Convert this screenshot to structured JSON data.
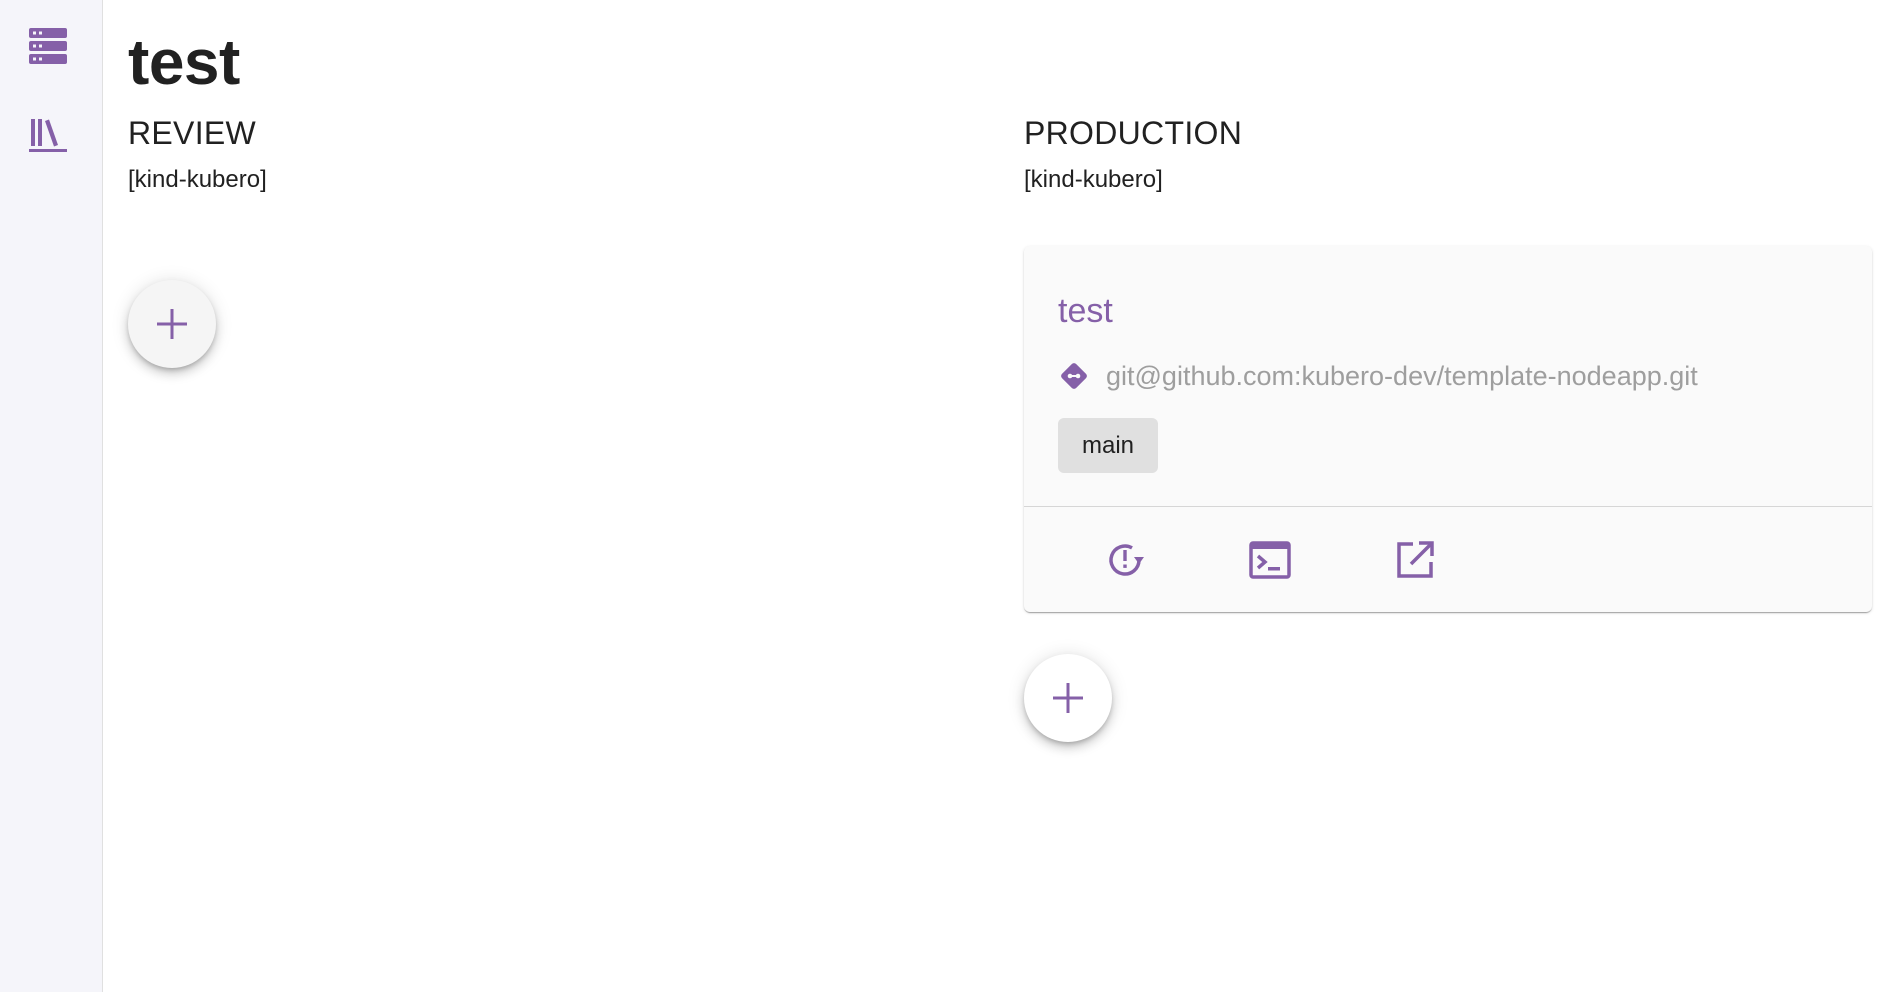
{
  "colors": {
    "accent": "#8560a8",
    "sidebar_bg": "#f5f5fa",
    "chip_bg": "#e0e0e0",
    "muted_text": "#9e9e9e"
  },
  "sidebar": {
    "items": [
      {
        "icon": "server-list-icon"
      },
      {
        "icon": "library-books-icon"
      }
    ]
  },
  "page": {
    "title": "test"
  },
  "phases": [
    {
      "title": "REVIEW",
      "cluster": "[kind-kubero]",
      "add_icon": "plus-icon"
    },
    {
      "title": "PRODUCTION",
      "cluster": "[kind-kubero]",
      "app": {
        "name": "test",
        "repo_icon": "git-icon",
        "repository": "git@github.com:kubero-dev/template-nodeapp.git",
        "branch": "main",
        "actions": [
          {
            "icon": "restart-alert-icon"
          },
          {
            "icon": "console-icon"
          },
          {
            "icon": "open-in-new-icon"
          }
        ]
      },
      "add_icon": "plus-icon"
    }
  ]
}
